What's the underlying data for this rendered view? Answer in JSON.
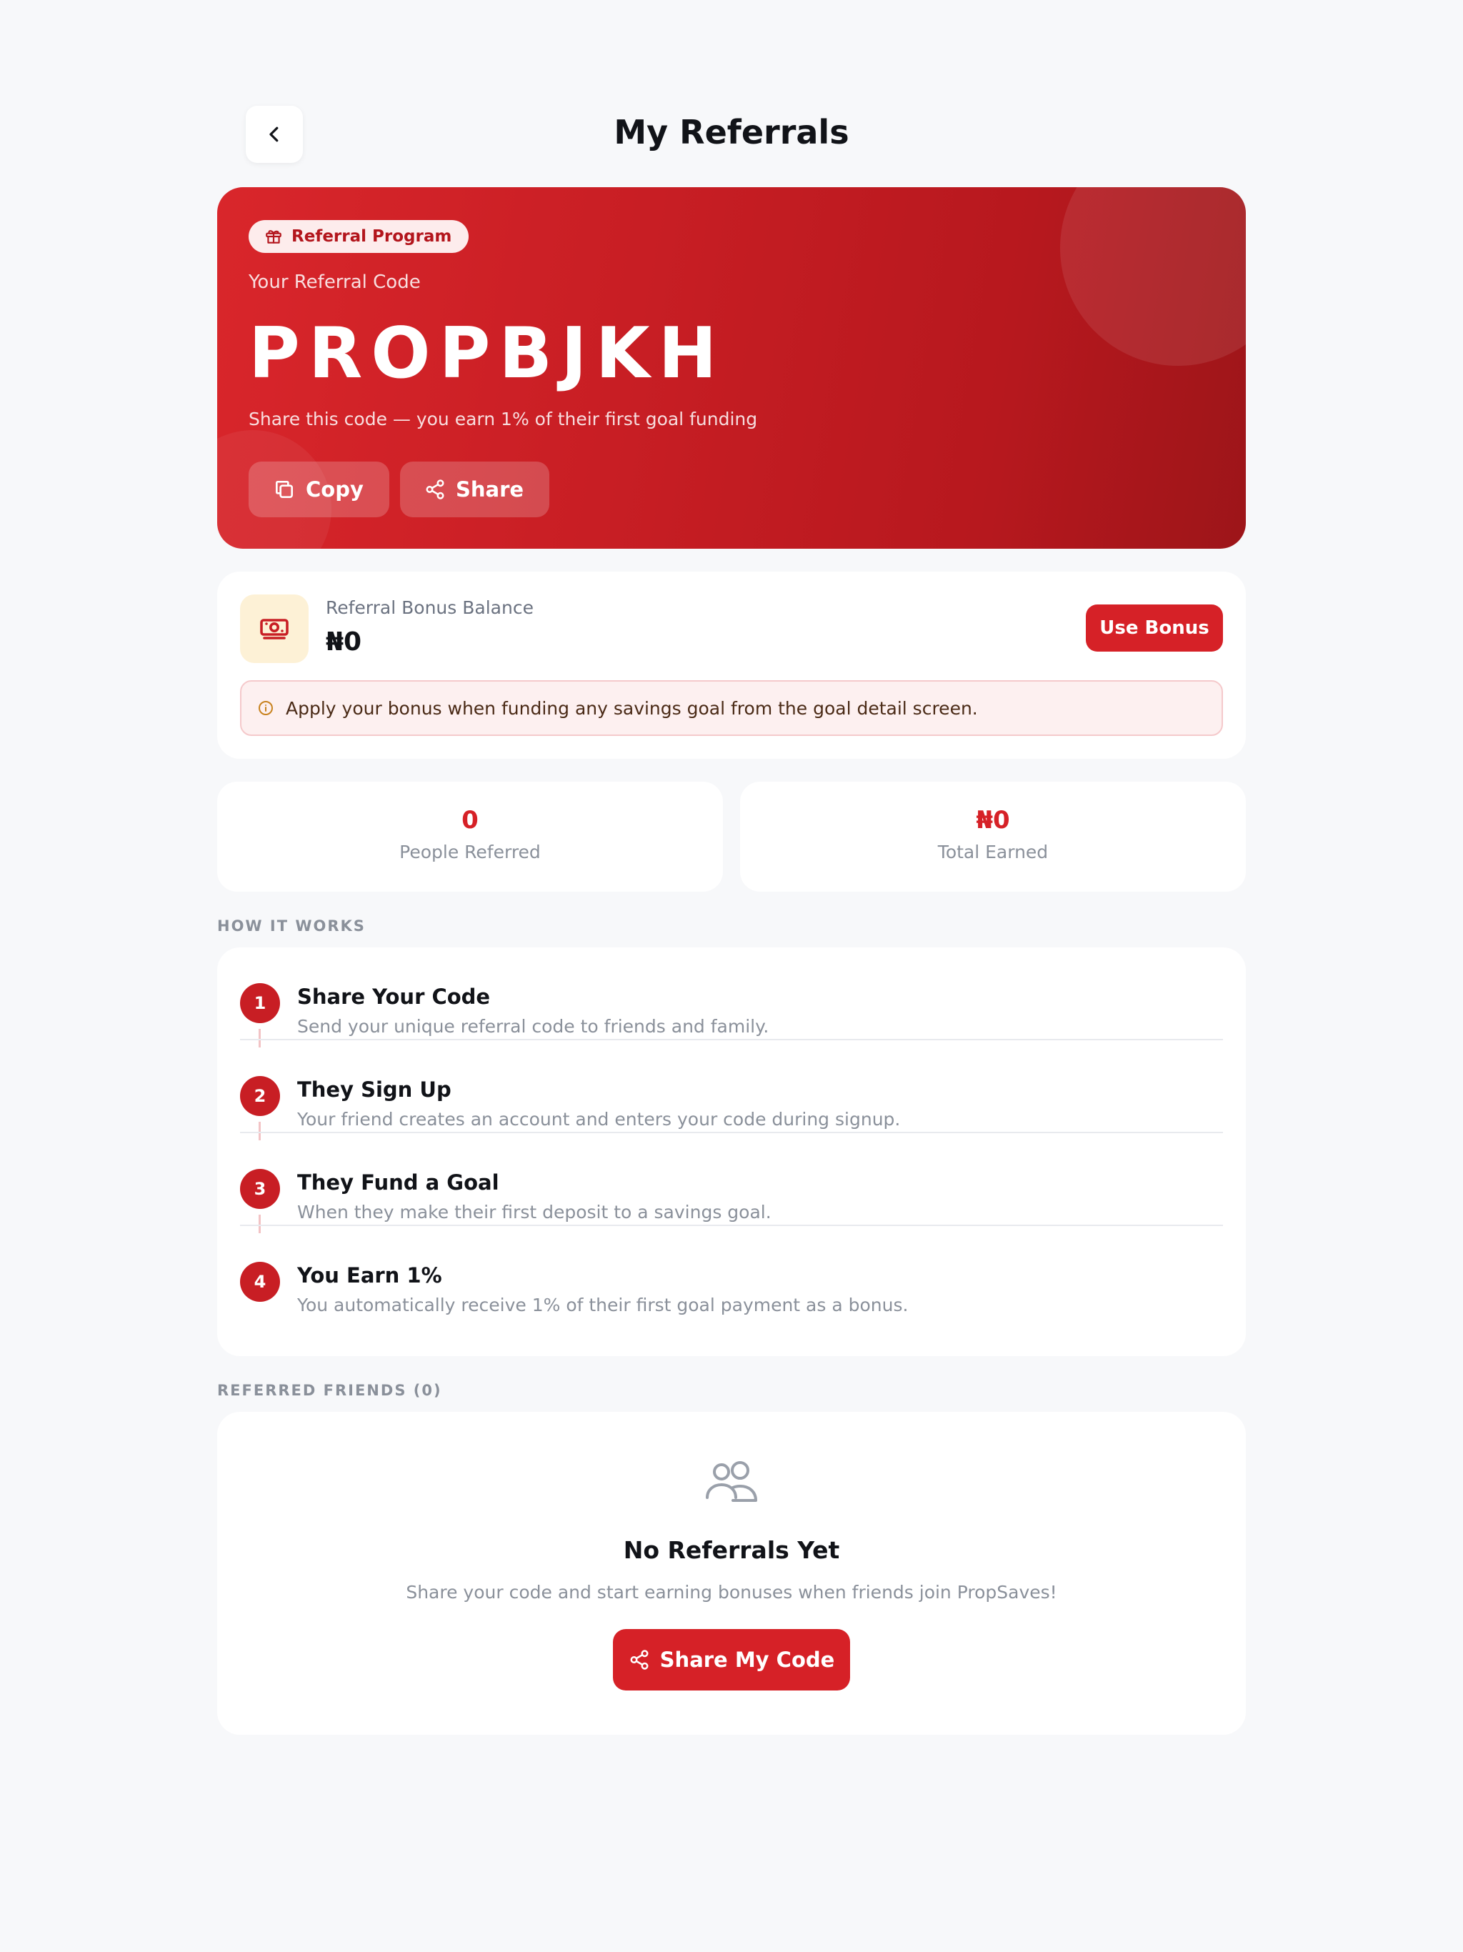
{
  "header": {
    "title": "My Referrals"
  },
  "hero": {
    "badge": "Referral Program",
    "label": "Your Referral Code",
    "code": "PROPBJKH",
    "subtitle": "Share this code — you earn 1% of their first goal funding",
    "copy_label": "Copy",
    "share_label": "Share"
  },
  "bonus": {
    "label": "Referral Bonus Balance",
    "value": "₦0",
    "use_label": "Use Bonus",
    "note": "Apply your bonus when funding any savings goal from the goal detail screen."
  },
  "stats": [
    {
      "value": "0",
      "label": "People Referred"
    },
    {
      "value": "₦0",
      "label": "Total Earned"
    }
  ],
  "how_it_works": {
    "title": "HOW IT WORKS",
    "steps": [
      {
        "num": "1",
        "title": "Share Your Code",
        "desc": "Send your unique referral code to friends and family."
      },
      {
        "num": "2",
        "title": "They Sign Up",
        "desc": "Your friend creates an account and enters your code during signup."
      },
      {
        "num": "3",
        "title": "They Fund a Goal",
        "desc": "When they make their first deposit to a savings goal."
      },
      {
        "num": "4",
        "title": "You Earn 1%",
        "desc": "You automatically receive 1% of their first goal payment as a bonus."
      }
    ]
  },
  "friends": {
    "title": "REFERRED FRIENDS (0)",
    "empty_title": "No Referrals Yet",
    "empty_desc": "Share your code and start earning bonuses when friends join PropSaves!",
    "button_label": "Share My Code"
  },
  "colors": {
    "accent": "#d62127",
    "page_bg": "#f7f8fa"
  }
}
